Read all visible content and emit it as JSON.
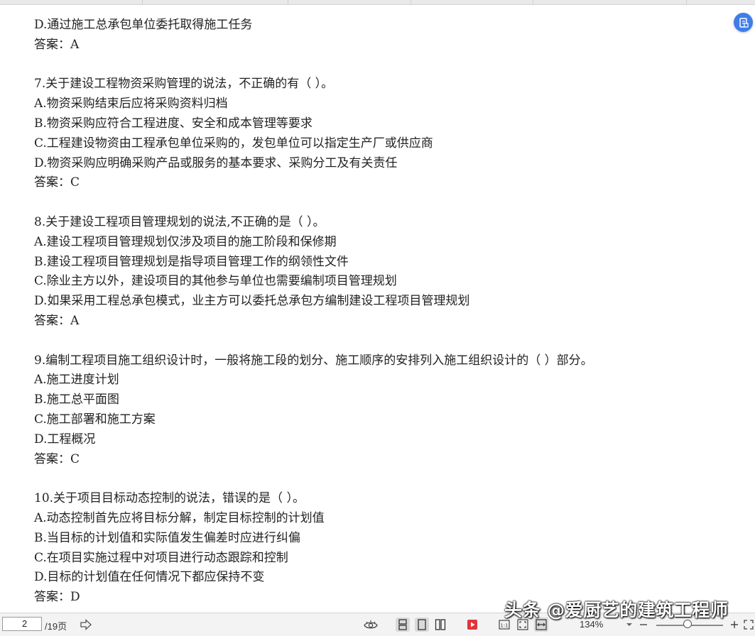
{
  "document": {
    "lines": [
      "D.通过施工总承包单位委托取得施工任务",
      "答案：A",
      "",
      "7.关于建设工程物资采购管理的说法，不正确的有（ ）。",
      "A.物资采购结束后应将采购资料归档",
      "B.物资采购应符合工程进度、安全和成本管理等要求",
      "C.工程建设物资由工程承包单位采购的，发包单位可以指定生产厂或供应商",
      "D.物资采购应明确采购产品或服务的基本要求、采购分工及有关责任",
      "答案：C",
      "",
      "8.关于建设工程项目管理规划的说法,不正确的是（ ）。",
      "A.建设工程项目管理规划仅涉及项目的施工阶段和保修期",
      "B.建设工程项目管理规划是指导项目管理工作的纲领性文件",
      "C.除业主方以外，建设项目的其他参与单位也需要编制项目管理规划",
      "D.如果采用工程总承包模式，业主方可以委托总承包方编制建设工程项目管理规划",
      "答案：A",
      "",
      "9.编制工程项目施工组织设计时，一般将施工段的划分、施工顺序的安排列入施工组织设计的（ ）部分。",
      "A.施工进度计划",
      "B.施工总平面图",
      "C.施工部署和施工方案",
      "D.工程概况",
      "答案：C",
      "",
      "10.关于项目目标动态控制的说法，错误的是（ ）。",
      "A.动态控制首先应将目标分解，制定目标控制的计划值",
      "B.当目标的计划值和实际值发生偏差时应进行纠偏",
      "C.在项目实施过程中对项目进行动态跟踪和控制",
      "D.目标的计划值在任何情况下都应保持不变",
      "答案：D"
    ]
  },
  "statusbar": {
    "current_page": "2",
    "total_pages": "/19页",
    "zoom": "134%"
  },
  "watermark": "头条 @爱厨艺的建筑工程师",
  "colors": {
    "accent": "#3f7de8",
    "play_red": "#e0353b"
  }
}
